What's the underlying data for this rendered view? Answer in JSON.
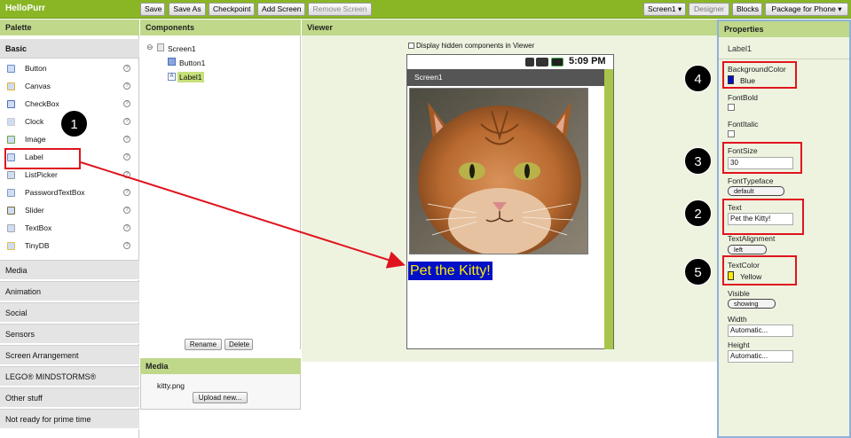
{
  "app": {
    "title": "HelloPurr"
  },
  "toolbar": {
    "save": "Save",
    "save_as": "Save As",
    "checkpoint": "Checkpoint",
    "add_screen": "Add Screen",
    "remove_screen": "Remove Screen",
    "screen_select": "Screen1 ▾",
    "designer": "Designer",
    "blocks": "Blocks",
    "package": "Package for Phone ▾"
  },
  "palette": {
    "header": "Palette",
    "basic": "Basic",
    "items": [
      {
        "label": "Button",
        "icon": "button-icon"
      },
      {
        "label": "Canvas",
        "icon": "canvas-icon"
      },
      {
        "label": "CheckBox",
        "icon": "checkbox-icon"
      },
      {
        "label": "Clock",
        "icon": "clock-icon"
      },
      {
        "label": "Image",
        "icon": "image-icon"
      },
      {
        "label": "Label",
        "icon": "label-icon"
      },
      {
        "label": "ListPicker",
        "icon": "listpicker-icon"
      },
      {
        "label": "PasswordTextBox",
        "icon": "password-icon"
      },
      {
        "label": "Slider",
        "icon": "slider-icon"
      },
      {
        "label": "TextBox",
        "icon": "textbox-icon"
      },
      {
        "label": "TinyDB",
        "icon": "database-icon"
      }
    ],
    "help_glyph": "?",
    "categories": [
      "Media",
      "Animation",
      "Social",
      "Sensors",
      "Screen Arrangement",
      "LEGO® MINDSTORMS®",
      "Other stuff",
      "Not ready for prime time"
    ]
  },
  "components": {
    "header": "Components",
    "collapse": "⊖",
    "tree": [
      "Screen1",
      "Button1",
      "Label1"
    ],
    "rename": "Rename",
    "delete": "Delete"
  },
  "media": {
    "header": "Media",
    "file": "kitty.png",
    "upload": "Upload new..."
  },
  "viewer": {
    "header": "Viewer",
    "hidden_toggle": "Display hidden components in Viewer",
    "phone": {
      "time": "5:09 PM",
      "screen_title": "Screen1",
      "label_text": "Pet the Kitty!"
    }
  },
  "properties": {
    "header": "Properties",
    "component": "Label1",
    "bg_color_name": "BackgroundColor",
    "bg_color_value": "Blue",
    "bg_swatch": "#0010c8",
    "fontbold": "FontBold",
    "fontitalic": "FontItalic",
    "fontsize": "FontSize",
    "fontsize_value": "30",
    "fonttypeface": "FontTypeface",
    "fonttypeface_value": "default",
    "text": "Text",
    "text_value": "Pet the Kitty!",
    "textalign": "TextAlignment",
    "textalign_value": "left",
    "textcolor": "TextColor",
    "textcolor_value": "Yellow",
    "text_swatch": "#ffea00",
    "visible": "Visible",
    "visible_value": "showing",
    "width": "Width",
    "width_value": "Automatic...",
    "height": "Height",
    "height_value": "Automatic..."
  },
  "annotations": [
    "1",
    "2",
    "3",
    "4",
    "5"
  ],
  "colors": {
    "accent": "#8ab626",
    "panel_header": "#bfd88a",
    "highlight": "#e0141e"
  }
}
